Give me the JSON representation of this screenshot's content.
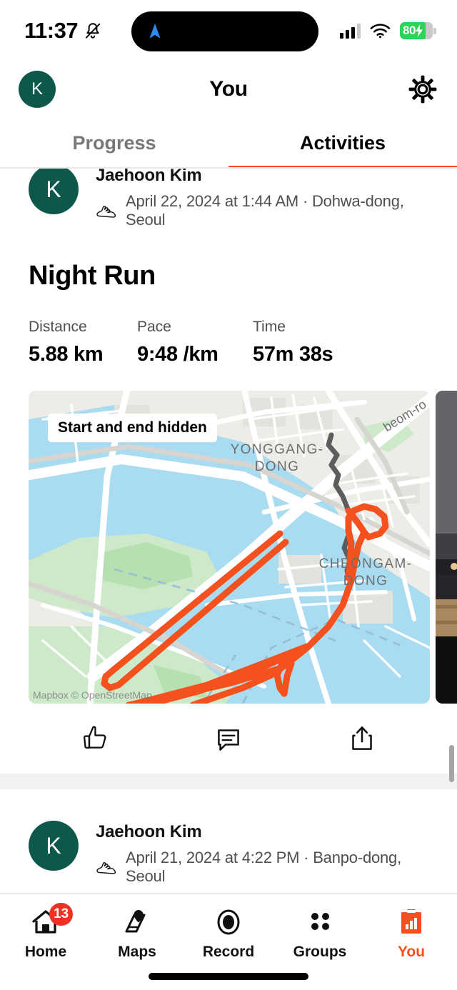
{
  "status_bar": {
    "time": "11:37",
    "notifications_icon": "bell-muted-icon",
    "location_icon": "location-arrow-icon",
    "signal_icon": "cellular-signal-icon",
    "wifi_icon": "wifi-icon",
    "battery_percent": "80",
    "battery_charging_icon": "charging-bolt-icon",
    "battery_color": "#30d158"
  },
  "header": {
    "avatar_initial": "K",
    "avatar_color": "#0d584a",
    "title": "You",
    "settings_icon": "gear-icon"
  },
  "tabs": {
    "accent_color": "#f5511e",
    "items": [
      {
        "label": "Progress",
        "active": false
      },
      {
        "label": "Activities",
        "active": true
      }
    ]
  },
  "feed": {
    "activities": [
      {
        "avatar_initial": "K",
        "user": "Jaehoon Kim",
        "sport_icon": "running-shoe-icon",
        "meta": "April 22, 2024 at 1:44 AM · Dohwa-dong, Seoul",
        "title": "Night Run",
        "stats": [
          {
            "label": "Distance",
            "value": "5.88 km"
          },
          {
            "label": "Pace",
            "value": "9:48 /km"
          },
          {
            "label": "Time",
            "value": "57m 38s"
          }
        ],
        "map": {
          "badge": "Start and end hidden",
          "attribution": "Mapbox © OpenStreetMap",
          "route_color": "#f5511e",
          "hidden_segment_color": "#5d5d5d",
          "labels": [
            "YONGGANG-",
            "DONG",
            "CHEONGAM-",
            "DONG",
            "beom-ro"
          ]
        },
        "actions": [
          {
            "name": "like",
            "icon": "thumbs-up-icon"
          },
          {
            "name": "comment",
            "icon": "comment-bubble-icon"
          },
          {
            "name": "share",
            "icon": "share-icon"
          }
        ]
      },
      {
        "avatar_initial": "K",
        "user": "Jaehoon Kim",
        "sport_icon": "running-shoe-icon",
        "meta": "April 21, 2024 at 4:22 PM · Banpo-dong, Seoul"
      }
    ]
  },
  "bottom_nav": {
    "active_color": "#f5511e",
    "items": [
      {
        "label": "Home",
        "icon": "home-icon",
        "badge": "13",
        "active": false
      },
      {
        "label": "Maps",
        "icon": "maps-icon",
        "active": false
      },
      {
        "label": "Record",
        "icon": "record-icon",
        "active": false
      },
      {
        "label": "Groups",
        "icon": "groups-icon",
        "active": false
      },
      {
        "label": "You",
        "icon": "you-clipboard-chart-icon",
        "active": true
      }
    ]
  }
}
